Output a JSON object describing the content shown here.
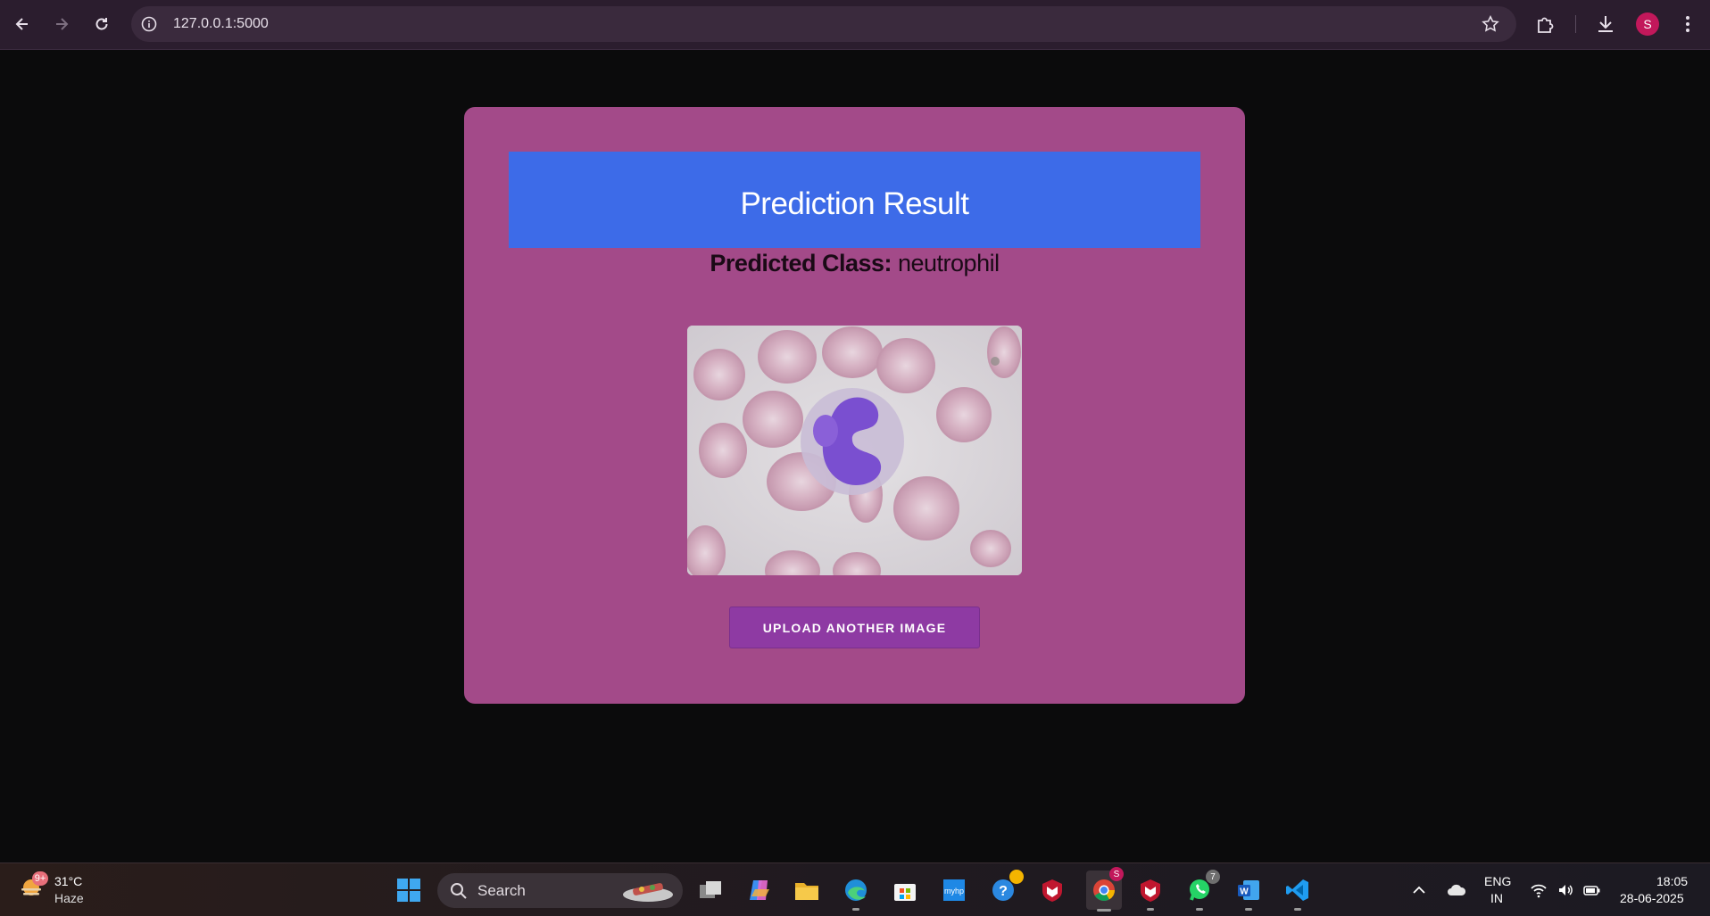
{
  "browser": {
    "url": "127.0.0.1:5000",
    "profile_initial": "S"
  },
  "page": {
    "heading": "Prediction Result",
    "predicted_label": "Predicted Class:",
    "predicted_value": " neutrophil",
    "image_subject": "blood smear microscopy image of a neutrophil",
    "upload_button": "UPLOAD ANOTHER IMAGE"
  },
  "taskbar": {
    "weather_temp": "31°C",
    "weather_desc": "Haze",
    "weather_badge": "9+",
    "search_label": "Search",
    "chrome_badge": "S",
    "whatsapp_badge": "7",
    "lang_line1": "ENG",
    "lang_line2": "IN",
    "time": "18:05",
    "date": "28-06-2025"
  },
  "colors": {
    "card": "#a34a89",
    "banner": "#3d6be8",
    "button": "#8e3aa3"
  }
}
